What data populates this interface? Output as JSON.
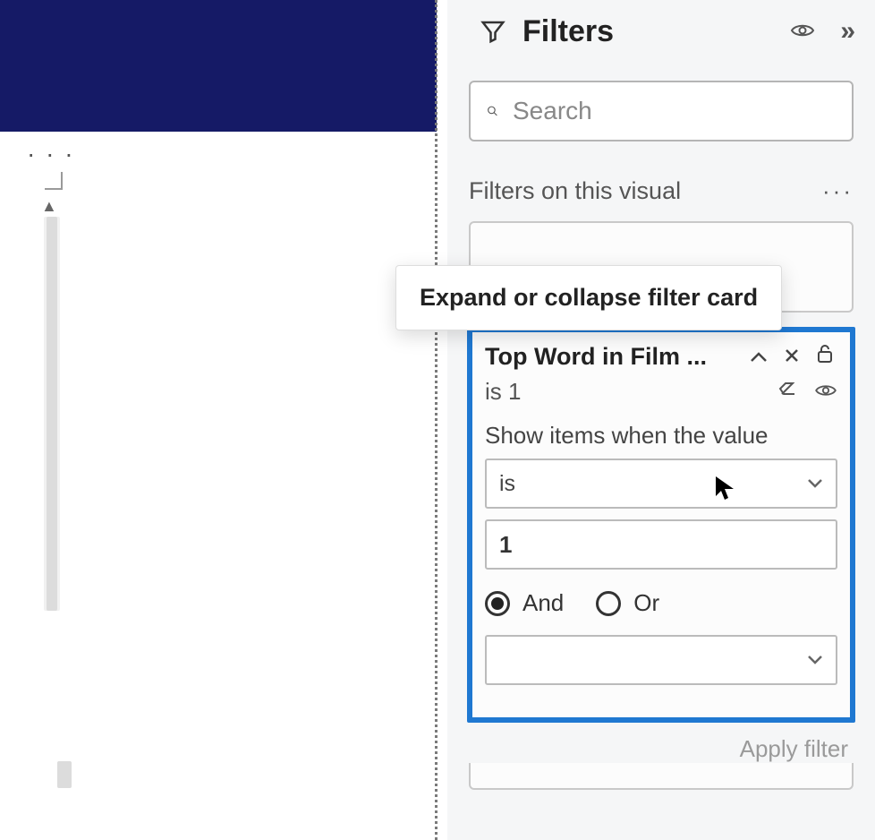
{
  "canvas": {
    "actions_ellipsis": "· · ·"
  },
  "pane": {
    "title": "Filters",
    "search_placeholder": "Search"
  },
  "section": {
    "title": "Filters on this visual"
  },
  "tooltip": {
    "text": "Expand or collapse filter card"
  },
  "filter_card": {
    "title": "Top Word in Film ...",
    "summary": "is 1",
    "instruction": "Show items when the value",
    "condition1_operator": "is",
    "condition1_value": "1",
    "logic_and": "And",
    "logic_or": "Or",
    "condition2_operator": ""
  },
  "apply": {
    "label": "Apply filter"
  }
}
